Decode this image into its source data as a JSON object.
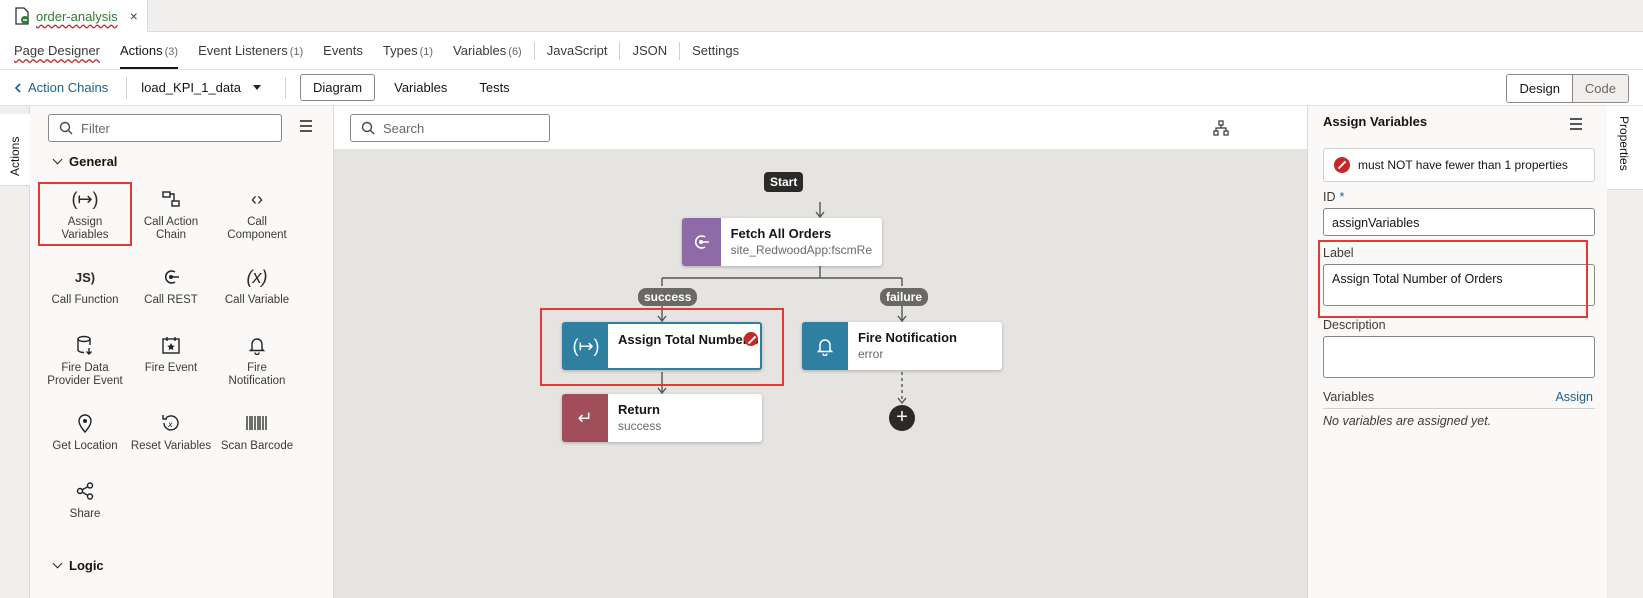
{
  "file_tab": {
    "label": "order-analysis",
    "close": "×"
  },
  "top_nav": [
    {
      "label": "Page Designer",
      "count": ""
    },
    {
      "label": "Actions",
      "count": "(3)"
    },
    {
      "label": "Event Listeners",
      "count": "(1)"
    },
    {
      "label": "Events",
      "count": ""
    },
    {
      "label": "Types",
      "count": "(1)"
    },
    {
      "label": "Variables",
      "count": "(6)"
    },
    {
      "label": "JavaScript",
      "count": ""
    },
    {
      "label": "JSON",
      "count": ""
    },
    {
      "label": "Settings",
      "count": ""
    }
  ],
  "sub_bar": {
    "back": "Action Chains",
    "chain": "load_KPI_1_data",
    "views": [
      "Diagram",
      "Variables",
      "Tests"
    ],
    "design": "Design",
    "code": "Code"
  },
  "left_tab": "Actions",
  "palette": {
    "filter_placeholder": "Filter",
    "general_title": "General",
    "logic_title": "Logic",
    "items": [
      {
        "label1": "Assign",
        "label2": "Variables",
        "icon": "assign-icon"
      },
      {
        "label1": "Call Action",
        "label2": "Chain",
        "icon": "chain-icon"
      },
      {
        "label1": "Call",
        "label2": "Component",
        "icon": "component-icon"
      },
      {
        "label1": "Call Function",
        "label2": "",
        "icon": "js-icon"
      },
      {
        "label1": "Call REST",
        "label2": "",
        "icon": "rest-icon"
      },
      {
        "label1": "Call Variable",
        "label2": "",
        "icon": "variable-icon"
      },
      {
        "label1": "Fire Data",
        "label2": "Provider Event",
        "icon": "database-icon"
      },
      {
        "label1": "Fire Event",
        "label2": "",
        "icon": "calendar-star-icon"
      },
      {
        "label1": "Fire",
        "label2": "Notification",
        "icon": "bell-icon"
      },
      {
        "label1": "Get Location",
        "label2": "",
        "icon": "location-icon"
      },
      {
        "label1": "Reset Variables",
        "label2": "",
        "icon": "reset-icon"
      },
      {
        "label1": "Scan Barcode",
        "label2": "",
        "icon": "barcode-icon"
      },
      {
        "label1": "Share",
        "label2": "",
        "icon": "share-icon"
      }
    ]
  },
  "canvas": {
    "search_placeholder": "Search",
    "start": "Start",
    "fetch": {
      "title": "Fetch All Orders",
      "subtitle": "site_RedwoodApp:fscmRe"
    },
    "success_pill": "success",
    "failure_pill": "failure",
    "assign": {
      "title": "Assign Total Number of Orders"
    },
    "notify": {
      "title": "Fire Notification",
      "subtitle": "error"
    },
    "ret": {
      "title": "Return",
      "subtitle": "success"
    },
    "add": "+"
  },
  "props": {
    "title": "Assign Variables",
    "error": "must NOT have fewer than 1 properties",
    "id_label": "ID",
    "required": "*",
    "id_value": "assignVariables",
    "label_label": "Label",
    "label_value": "Assign Total Number of Orders",
    "desc_label": "Description",
    "desc_value": "",
    "vars_label": "Variables",
    "assign_link": "Assign",
    "empty_note": "No variables are assigned yet."
  },
  "right_tab": "Properties",
  "colors": {
    "accent_red": "#e53935",
    "assign_tile": "#2e7fa1",
    "fetch_tile": "#8e6aa6",
    "return_tile": "#a14d5a"
  }
}
